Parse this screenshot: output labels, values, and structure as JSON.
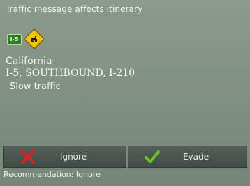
{
  "header": {
    "title": "Traffic message affects itinerary"
  },
  "icons": {
    "route_shield_label": "I-5",
    "route_shield_icon": "route-shield-icon",
    "warning_icon": "traffic-warning-icon"
  },
  "message": {
    "region": "California",
    "road": "I-5, SOUTHBOUND, I-210",
    "status": "Slow traffic"
  },
  "actions": {
    "ignore": {
      "label": "Ignore",
      "icon": "x-icon"
    },
    "evade": {
      "label": "Evade",
      "icon": "check-icon"
    }
  },
  "footer": {
    "recommendation": "Recommendation: Ignore"
  },
  "colors": {
    "background": "#7f8f80",
    "button": "#4b554e",
    "x_icon": "#e21f1f",
    "check_icon": "#63c91f",
    "warning_diamond": "#f4c400",
    "shield": "#2e7a2e"
  }
}
